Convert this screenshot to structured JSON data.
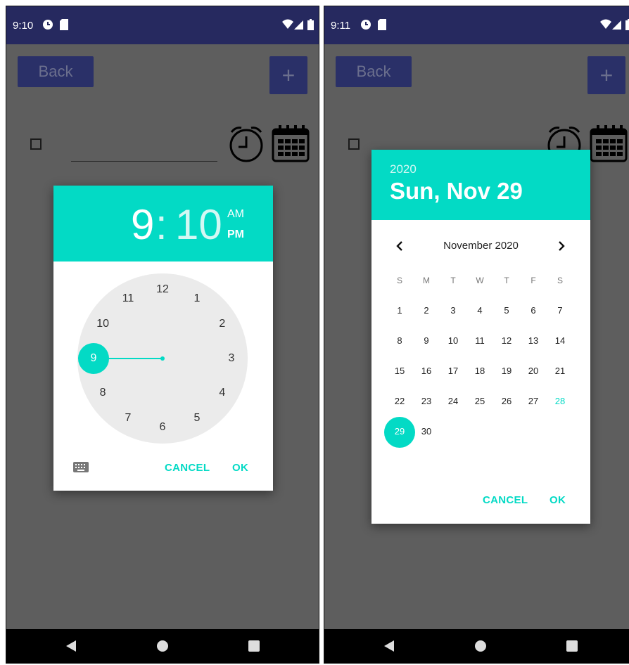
{
  "left": {
    "status": {
      "time": "9:10"
    },
    "back_label": "Back",
    "plus_label": "+",
    "time_picker": {
      "hour": "9",
      "colon": ":",
      "minute": "10",
      "am": "AM",
      "pm": "PM",
      "selected_period": "AM",
      "clock_numbers": [
        "12",
        "1",
        "2",
        "3",
        "4",
        "5",
        "6",
        "7",
        "8",
        "9",
        "10",
        "11"
      ],
      "selected_hour": "9",
      "cancel": "CANCEL",
      "ok": "OK"
    }
  },
  "right": {
    "status": {
      "time": "9:11"
    },
    "back_label": "Back",
    "plus_label": "+",
    "date_picker": {
      "year": "2020",
      "date": "Sun, Nov 29",
      "month_title": "November 2020",
      "weekdays": [
        "S",
        "M",
        "T",
        "W",
        "T",
        "F",
        "S"
      ],
      "weeks": [
        [
          "1",
          "2",
          "3",
          "4",
          "5",
          "6",
          "7"
        ],
        [
          "8",
          "9",
          "10",
          "11",
          "12",
          "13",
          "14"
        ],
        [
          "15",
          "16",
          "17",
          "18",
          "19",
          "20",
          "21"
        ],
        [
          "22",
          "23",
          "24",
          "25",
          "26",
          "27",
          "28"
        ],
        [
          "29",
          "30",
          "",
          "",
          "",
          "",
          ""
        ]
      ],
      "selected_day": "29",
      "today": "28",
      "cancel": "CANCEL",
      "ok": "OK"
    }
  },
  "colors": {
    "accent": "#03dac5",
    "status_bar": "#26295f",
    "scrim": "#5e5e5e"
  }
}
